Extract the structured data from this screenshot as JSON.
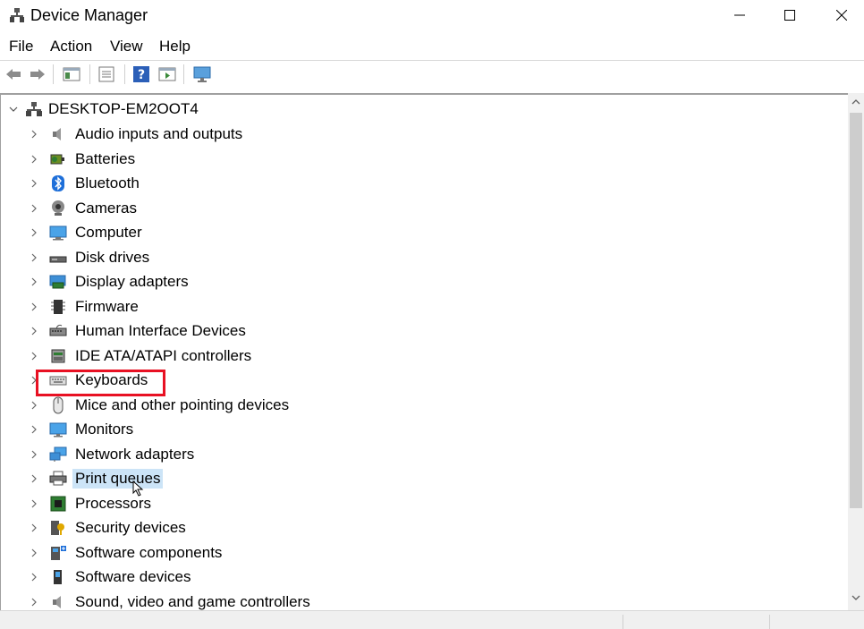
{
  "window": {
    "title": "Device Manager"
  },
  "menu": [
    "File",
    "Action",
    "View",
    "Help"
  ],
  "tree": {
    "root": "DESKTOP-EM2OOT4",
    "items": [
      {
        "label": "Audio inputs and outputs",
        "icon": "speaker-icon"
      },
      {
        "label": "Batteries",
        "icon": "battery-icon"
      },
      {
        "label": "Bluetooth",
        "icon": "bluetooth-icon"
      },
      {
        "label": "Cameras",
        "icon": "webcam-icon"
      },
      {
        "label": "Computer",
        "icon": "computer-icon"
      },
      {
        "label": "Disk drives",
        "icon": "disk-drive-icon"
      },
      {
        "label": "Display adapters",
        "icon": "display-adapter-icon"
      },
      {
        "label": "Firmware",
        "icon": "firmware-chip-icon"
      },
      {
        "label": "Human Interface Devices",
        "icon": "hid-icon"
      },
      {
        "label": "IDE ATA/ATAPI controllers",
        "icon": "ide-controller-icon"
      },
      {
        "label": "Keyboards",
        "icon": "keyboard-icon"
      },
      {
        "label": "Mice and other pointing devices",
        "icon": "mouse-icon"
      },
      {
        "label": "Monitors",
        "icon": "monitor-icon"
      },
      {
        "label": "Network adapters",
        "icon": "network-icon"
      },
      {
        "label": "Print queues",
        "icon": "printer-icon",
        "selected": true
      },
      {
        "label": "Processors",
        "icon": "processor-icon"
      },
      {
        "label": "Security devices",
        "icon": "security-device-icon"
      },
      {
        "label": "Software components",
        "icon": "software-component-icon"
      },
      {
        "label": "Software devices",
        "icon": "software-device-icon"
      },
      {
        "label": "Sound, video and game controllers",
        "icon": "sound-controller-icon"
      }
    ]
  },
  "colors": {
    "selection": "#cce4f7",
    "highlight_box": "#e81123"
  }
}
